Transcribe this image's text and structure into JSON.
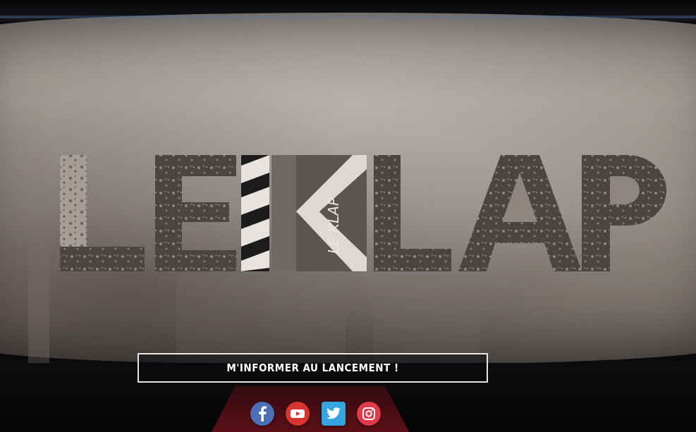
{
  "brand": {
    "logo_text": "LE KLAP",
    "logo_icon_text": "LE KLAP"
  },
  "cta": {
    "label": "M'INFORMER AU LANCEMENT !"
  },
  "social": [
    {
      "name": "facebook",
      "icon": "facebook-icon",
      "color": "#4a6fb5"
    },
    {
      "name": "youtube",
      "icon": "youtube-icon",
      "color": "#d8332e"
    },
    {
      "name": "twitter",
      "icon": "twitter-icon",
      "color": "#33a6e0"
    },
    {
      "name": "instagram",
      "icon": "instagram-icon",
      "color": "#e23a4a"
    }
  ]
}
